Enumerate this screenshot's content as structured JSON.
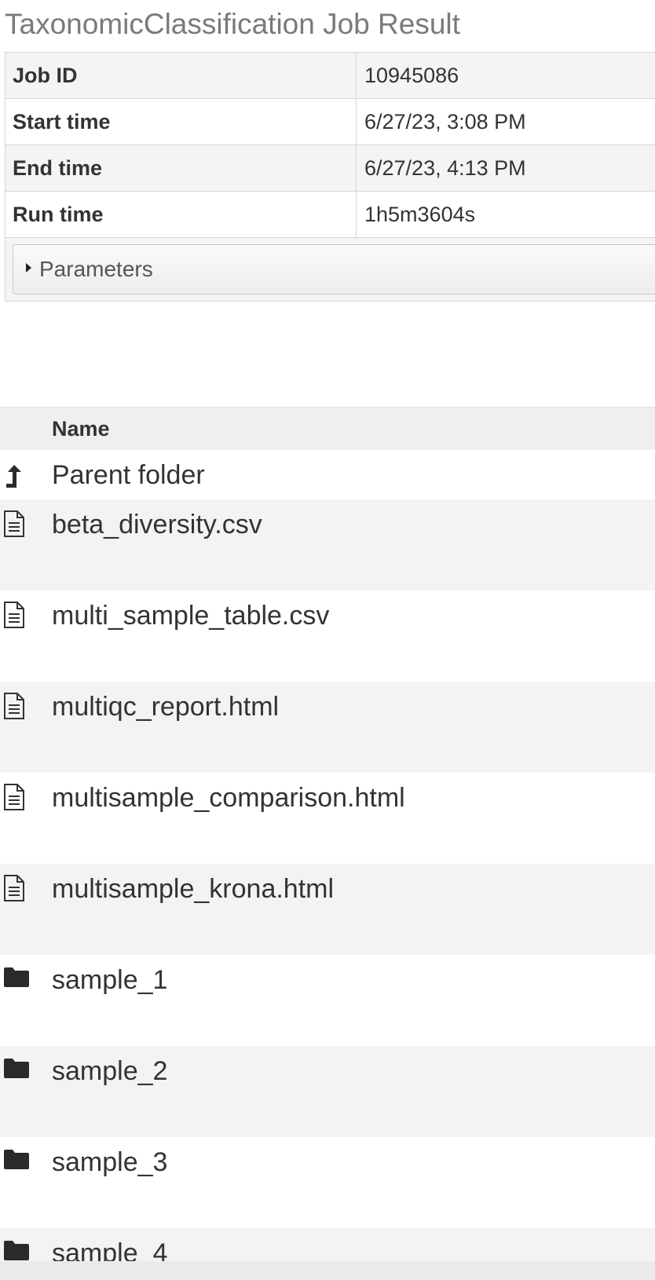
{
  "page": {
    "title": "TaxonomicClassification Job Result"
  },
  "job": {
    "rows": [
      {
        "label": "Job ID",
        "value": "10945086"
      },
      {
        "label": "Start time",
        "value": "6/27/23, 3:08 PM"
      },
      {
        "label": "End time",
        "value": "6/27/23, 4:13 PM"
      },
      {
        "label": "Run time",
        "value": "1h5m3604s"
      }
    ],
    "parameters_label": "Parameters",
    "parameters_icon": "caret-right-icon"
  },
  "files": {
    "name_header": "Name",
    "parent_label": "Parent folder",
    "parent_icon": "level-up-icon",
    "items": [
      {
        "name": "beta_diversity.csv",
        "icon": "file-icon"
      },
      {
        "name": "multi_sample_table.csv",
        "icon": "file-icon"
      },
      {
        "name": "multiqc_report.html",
        "icon": "file-icon"
      },
      {
        "name": "multisample_comparison.html",
        "icon": "file-icon"
      },
      {
        "name": "multisample_krona.html",
        "icon": "file-icon"
      },
      {
        "name": "sample_1",
        "icon": "folder-icon"
      },
      {
        "name": "sample_2",
        "icon": "folder-icon"
      },
      {
        "name": "sample_3",
        "icon": "folder-icon"
      },
      {
        "name": "sample_4",
        "icon": "folder-icon"
      }
    ]
  },
  "colors": {
    "title": "#7a7a7a",
    "row_shade": "#f3f3f3",
    "header_bg": "#efefef",
    "text": "#333333"
  }
}
